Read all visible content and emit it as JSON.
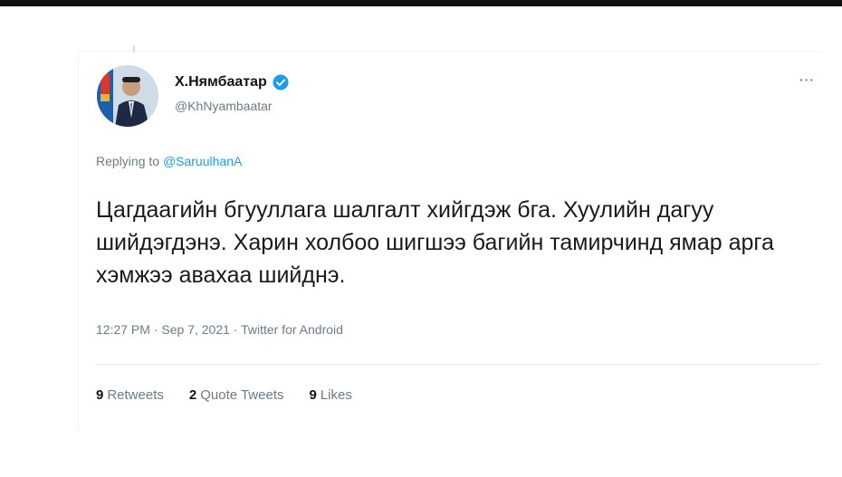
{
  "tweet": {
    "author": {
      "display_name": "Х.Нямбаатар",
      "handle": "@KhNyambaatar",
      "verified": true
    },
    "reply": {
      "prefix": "Replying to",
      "to_handle": "@SaruulhanA"
    },
    "text": "Цагдаагийн бгууллага шалгалт хийгдэж бга. Хуулийн дагуу шийдэгдэнэ. Харин холбоо шигшээ багийн тамирчинд ямар арга хэмжээ авахаа шийднэ.",
    "meta": {
      "time": "12:27 PM",
      "date": "Sep 7, 2021",
      "client": "Twitter for Android",
      "separator": "·"
    },
    "stats": {
      "retweets_count": "9",
      "retweets_label": "Retweets",
      "quotes_count": "2",
      "quotes_label": "Quote Tweets",
      "likes_count": "9",
      "likes_label": "Likes"
    },
    "more_label": "···"
  },
  "colors": {
    "accent": "#1d9bf0",
    "muted": "#6b7b87",
    "text": "#0f1419"
  }
}
